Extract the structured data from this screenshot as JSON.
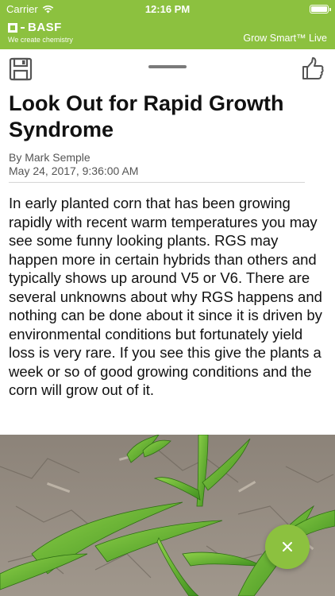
{
  "status_bar": {
    "carrier": "Carrier",
    "time": "12:16 PM"
  },
  "brand": {
    "logo": "BASF",
    "tagline": "We create chemistry",
    "app_name": "Grow Smart™ Live"
  },
  "icons": {
    "save": "save-icon",
    "like": "thumbs-up-icon",
    "close": "close-icon",
    "wifi": "wifi-icon",
    "battery": "battery-icon"
  },
  "colors": {
    "accent": "#8cc13f",
    "text": "#111111",
    "meta": "#555555"
  },
  "article": {
    "title": "Look Out for Rapid Growth Syndrome",
    "author": "By Mark Semple",
    "date": "May 24, 2017, 9:36:00 AM",
    "body": "In early planted corn that has been growing rapidly with recent warm temperatures you may see some funny looking plants. RGS may happen more in certain hybrids than others and typically shows up around V5 or V6. There are several unknowns about why RGS happens and nothing can be done about it since it is driven by environmental conditions but fortunately yield loss is very rare. If you see this give the plants a week or so of good growing conditions and the corn will grow out of it."
  }
}
